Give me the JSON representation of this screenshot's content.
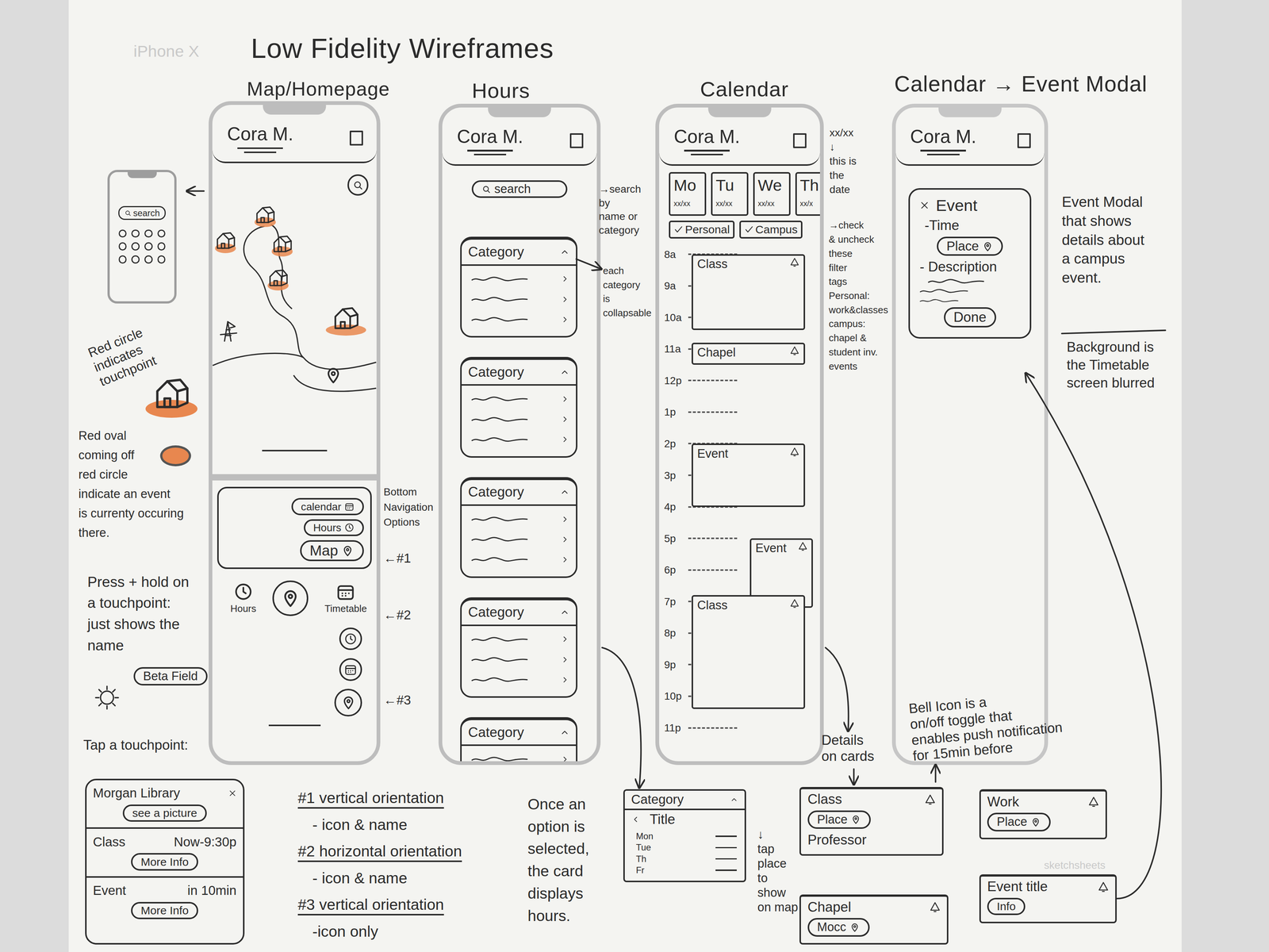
{
  "watermarks": [
    "iPhone X",
    "sketchsheets"
  ],
  "title": "Low Fidelity Wireframes",
  "user": "Cora M.",
  "headings": [
    "Map/Homepage",
    "Hours",
    "Calendar",
    "Calendar → Event Modal"
  ],
  "legend": {
    "mini_phone": {
      "search": "search"
    },
    "touchpoint_note": [
      "Red circle",
      "indicates",
      "touchpoint"
    ],
    "event_note": [
      "Red oval",
      "coming off",
      "red circle",
      "indicate an event",
      "is currenty occuring",
      "there."
    ],
    "hold_note": [
      "Press + hold on",
      "a touchpoint:",
      "just shows the",
      "name"
    ],
    "hold_label": "Beta Field",
    "tap_note": "Tap a touchpoint:",
    "popup": {
      "title": "Morgan Library",
      "picture": "see a picture",
      "rows": [
        {
          "kind": "Class",
          "time": "Now-9:30p",
          "action": "More Info"
        },
        {
          "kind": "Event",
          "time": "in 10min",
          "action": "More Info"
        }
      ]
    }
  },
  "map_screen": {
    "touchpoints": [
      {
        "event": false
      },
      {
        "event": false
      },
      {
        "event": false
      },
      {
        "event": false
      },
      {
        "event": true
      }
    ],
    "nav_vertical": [
      {
        "label": "calendar",
        "kind": "calendar"
      },
      {
        "label": "Hours",
        "kind": "clock"
      },
      {
        "label": "Map",
        "kind": "pin"
      }
    ],
    "nav_horizontal": [
      {
        "label": "Hours",
        "kind": "clock"
      },
      {
        "kind": "pin"
      },
      {
        "label": "Timetable",
        "kind": "calendar"
      }
    ],
    "nav_icons": [
      {
        "kind": "clock"
      },
      {
        "kind": "calendar"
      },
      {
        "kind": "pin"
      }
    ],
    "markers": [
      "←#1",
      "←#2",
      "←#3"
    ],
    "nav_note": [
      "Bottom",
      "Navigation",
      "Options"
    ],
    "orientation_notes": [
      {
        "title": "#1 vertical orientation",
        "detail": "- icon & name"
      },
      {
        "title": "#2 horizontal orientation",
        "detail": "- icon & name"
      },
      {
        "title": "#3 vertical orientation",
        "detail": "-icon only"
      }
    ]
  },
  "hours_screen": {
    "search": "search",
    "search_note": [
      "→search",
      "by",
      "name or",
      "category"
    ],
    "collapse_note": [
      "each",
      "category",
      "is",
      "collapsable"
    ],
    "categories": [
      {
        "title": "Category",
        "expanded": true,
        "rows": 3
      },
      {
        "title": "Category",
        "expanded": true,
        "rows": 3
      },
      {
        "title": "Category",
        "expanded": true,
        "rows": 3
      },
      {
        "title": "Category",
        "expanded": true,
        "rows": 3
      },
      {
        "title": "Category",
        "expanded": true,
        "rows": 3
      }
    ],
    "selected_note": [
      "Once an",
      "option is",
      "selected,",
      "the card",
      "displays",
      "hours."
    ],
    "detail_card": {
      "category": "Category",
      "title": "Title",
      "days": [
        "Mon",
        "Tue",
        "Th",
        "Fr"
      ]
    }
  },
  "calendar_screen": {
    "days": [
      {
        "day": "Mo",
        "date": "xx/xx"
      },
      {
        "day": "Tu",
        "date": "xx/xx"
      },
      {
        "day": "We",
        "date": "xx/xx"
      },
      {
        "day": "Th",
        "date": "xx/x"
      }
    ],
    "filters": [
      {
        "label": "Personal",
        "checked": true
      },
      {
        "label": "Campus",
        "checked": true
      }
    ],
    "times": [
      "8a",
      "9a",
      "10a",
      "11a",
      "12p",
      "1p",
      "2p",
      "3p",
      "4p",
      "5p",
      "6p",
      "7p",
      "8p",
      "9p",
      "10p",
      "11p"
    ],
    "events": [
      {
        "title": "Class",
        "start": 8,
        "end": 10.4,
        "lane": 0
      },
      {
        "title": "Chapel",
        "start": 10.8,
        "end": 11.5,
        "lane": 0
      },
      {
        "title": "Event",
        "start": 14,
        "end": 16,
        "lane": 0
      },
      {
        "title": "Event",
        "start": 17,
        "end": 19.2,
        "lane": 1
      },
      {
        "title": "Class",
        "start": 18.8,
        "end": 22.4,
        "lane": 0
      }
    ],
    "date_note": [
      "xx/xx",
      "↓",
      "this is",
      "the",
      "date"
    ],
    "filter_note": [
      "→check",
      "& uncheck",
      "these",
      "filter",
      "tags",
      "Personal:",
      "work&classes",
      "campus:",
      "chapel &",
      "student inv.",
      "events"
    ],
    "details_note": [
      "Details",
      "on cards"
    ],
    "tap_note": [
      "↓",
      "tap",
      "place",
      "to",
      "show",
      "on map"
    ],
    "bell_note": [
      "Bell Icon is a",
      "on/off toggle that",
      "enables push notification",
      "for 15min before"
    ],
    "cards": [
      {
        "title": "Class",
        "place": "Place",
        "detail": "Professor"
      },
      {
        "title": "Chapel",
        "place": "Mocc"
      },
      {
        "title": "Work",
        "place": "Place"
      },
      {
        "title": "Event title",
        "info": "Info"
      }
    ]
  },
  "event_modal": {
    "title": "Event",
    "time": "-Time",
    "place": "Place",
    "description": "- Description",
    "done": "Done",
    "note": [
      "Event Modal",
      "that shows",
      "details about",
      "a campus",
      "event."
    ],
    "background_note": [
      "Background is",
      "the Timetable",
      "screen blurred"
    ]
  }
}
